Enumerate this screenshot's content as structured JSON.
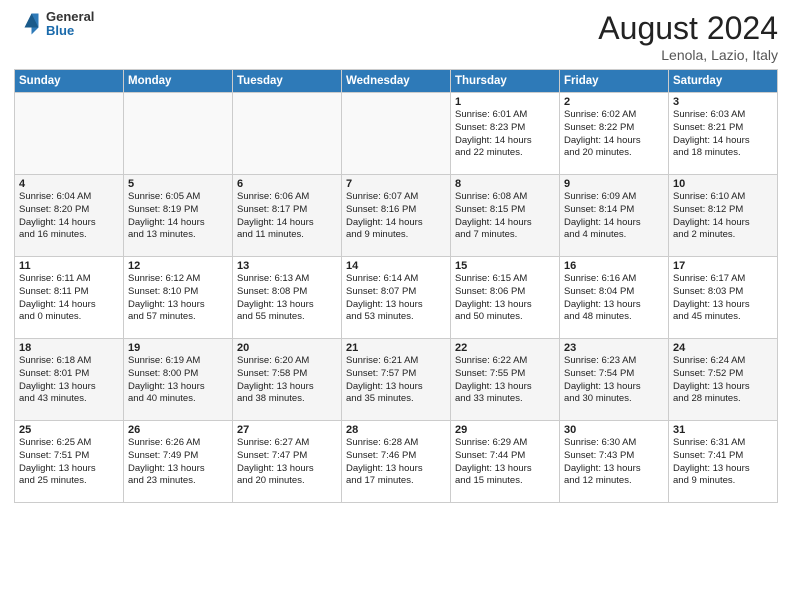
{
  "header": {
    "logo_general": "General",
    "logo_blue": "Blue",
    "month_title": "August 2024",
    "location": "Lenola, Lazio, Italy"
  },
  "days_of_week": [
    "Sunday",
    "Monday",
    "Tuesday",
    "Wednesday",
    "Thursday",
    "Friday",
    "Saturday"
  ],
  "weeks": [
    [
      {
        "day": "",
        "info": ""
      },
      {
        "day": "",
        "info": ""
      },
      {
        "day": "",
        "info": ""
      },
      {
        "day": "",
        "info": ""
      },
      {
        "day": "1",
        "info": "Sunrise: 6:01 AM\nSunset: 8:23 PM\nDaylight: 14 hours\nand 22 minutes."
      },
      {
        "day": "2",
        "info": "Sunrise: 6:02 AM\nSunset: 8:22 PM\nDaylight: 14 hours\nand 20 minutes."
      },
      {
        "day": "3",
        "info": "Sunrise: 6:03 AM\nSunset: 8:21 PM\nDaylight: 14 hours\nand 18 minutes."
      }
    ],
    [
      {
        "day": "4",
        "info": "Sunrise: 6:04 AM\nSunset: 8:20 PM\nDaylight: 14 hours\nand 16 minutes."
      },
      {
        "day": "5",
        "info": "Sunrise: 6:05 AM\nSunset: 8:19 PM\nDaylight: 14 hours\nand 13 minutes."
      },
      {
        "day": "6",
        "info": "Sunrise: 6:06 AM\nSunset: 8:17 PM\nDaylight: 14 hours\nand 11 minutes."
      },
      {
        "day": "7",
        "info": "Sunrise: 6:07 AM\nSunset: 8:16 PM\nDaylight: 14 hours\nand 9 minutes."
      },
      {
        "day": "8",
        "info": "Sunrise: 6:08 AM\nSunset: 8:15 PM\nDaylight: 14 hours\nand 7 minutes."
      },
      {
        "day": "9",
        "info": "Sunrise: 6:09 AM\nSunset: 8:14 PM\nDaylight: 14 hours\nand 4 minutes."
      },
      {
        "day": "10",
        "info": "Sunrise: 6:10 AM\nSunset: 8:12 PM\nDaylight: 14 hours\nand 2 minutes."
      }
    ],
    [
      {
        "day": "11",
        "info": "Sunrise: 6:11 AM\nSunset: 8:11 PM\nDaylight: 14 hours\nand 0 minutes."
      },
      {
        "day": "12",
        "info": "Sunrise: 6:12 AM\nSunset: 8:10 PM\nDaylight: 13 hours\nand 57 minutes."
      },
      {
        "day": "13",
        "info": "Sunrise: 6:13 AM\nSunset: 8:08 PM\nDaylight: 13 hours\nand 55 minutes."
      },
      {
        "day": "14",
        "info": "Sunrise: 6:14 AM\nSunset: 8:07 PM\nDaylight: 13 hours\nand 53 minutes."
      },
      {
        "day": "15",
        "info": "Sunrise: 6:15 AM\nSunset: 8:06 PM\nDaylight: 13 hours\nand 50 minutes."
      },
      {
        "day": "16",
        "info": "Sunrise: 6:16 AM\nSunset: 8:04 PM\nDaylight: 13 hours\nand 48 minutes."
      },
      {
        "day": "17",
        "info": "Sunrise: 6:17 AM\nSunset: 8:03 PM\nDaylight: 13 hours\nand 45 minutes."
      }
    ],
    [
      {
        "day": "18",
        "info": "Sunrise: 6:18 AM\nSunset: 8:01 PM\nDaylight: 13 hours\nand 43 minutes."
      },
      {
        "day": "19",
        "info": "Sunrise: 6:19 AM\nSunset: 8:00 PM\nDaylight: 13 hours\nand 40 minutes."
      },
      {
        "day": "20",
        "info": "Sunrise: 6:20 AM\nSunset: 7:58 PM\nDaylight: 13 hours\nand 38 minutes."
      },
      {
        "day": "21",
        "info": "Sunrise: 6:21 AM\nSunset: 7:57 PM\nDaylight: 13 hours\nand 35 minutes."
      },
      {
        "day": "22",
        "info": "Sunrise: 6:22 AM\nSunset: 7:55 PM\nDaylight: 13 hours\nand 33 minutes."
      },
      {
        "day": "23",
        "info": "Sunrise: 6:23 AM\nSunset: 7:54 PM\nDaylight: 13 hours\nand 30 minutes."
      },
      {
        "day": "24",
        "info": "Sunrise: 6:24 AM\nSunset: 7:52 PM\nDaylight: 13 hours\nand 28 minutes."
      }
    ],
    [
      {
        "day": "25",
        "info": "Sunrise: 6:25 AM\nSunset: 7:51 PM\nDaylight: 13 hours\nand 25 minutes."
      },
      {
        "day": "26",
        "info": "Sunrise: 6:26 AM\nSunset: 7:49 PM\nDaylight: 13 hours\nand 23 minutes."
      },
      {
        "day": "27",
        "info": "Sunrise: 6:27 AM\nSunset: 7:47 PM\nDaylight: 13 hours\nand 20 minutes."
      },
      {
        "day": "28",
        "info": "Sunrise: 6:28 AM\nSunset: 7:46 PM\nDaylight: 13 hours\nand 17 minutes."
      },
      {
        "day": "29",
        "info": "Sunrise: 6:29 AM\nSunset: 7:44 PM\nDaylight: 13 hours\nand 15 minutes."
      },
      {
        "day": "30",
        "info": "Sunrise: 6:30 AM\nSunset: 7:43 PM\nDaylight: 13 hours\nand 12 minutes."
      },
      {
        "day": "31",
        "info": "Sunrise: 6:31 AM\nSunset: 7:41 PM\nDaylight: 13 hours\nand 9 minutes."
      }
    ]
  ]
}
